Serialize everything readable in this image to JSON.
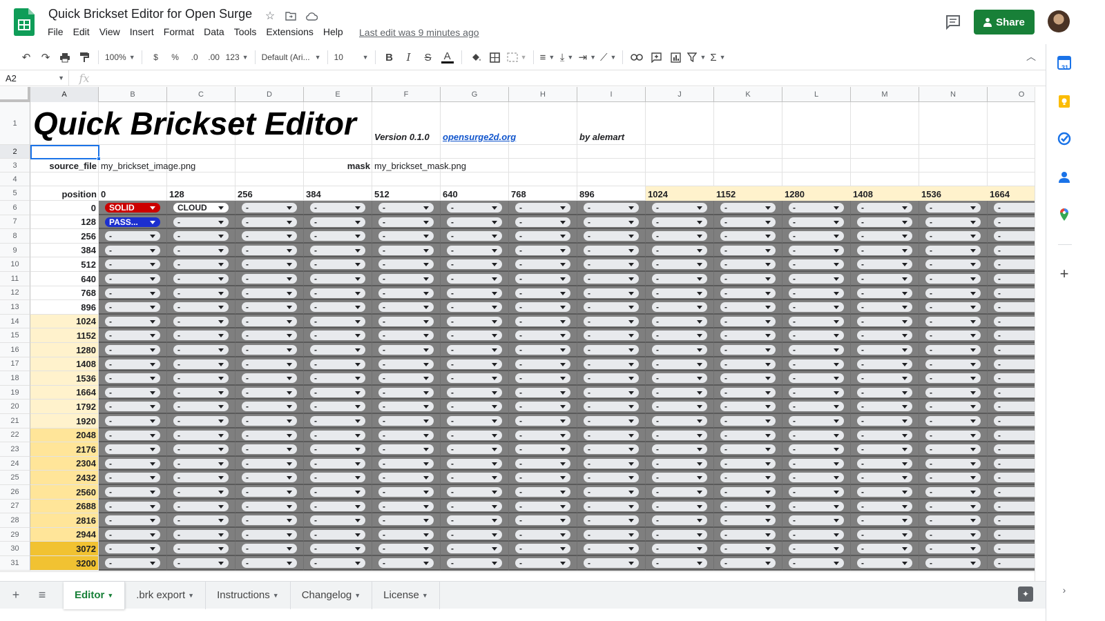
{
  "app": {
    "doc_title": "Quick Brickset Editor for Open Surge",
    "last_edit": "Last edit was 9 minutes ago",
    "share_label": "Share",
    "menu": [
      "File",
      "Edit",
      "View",
      "Insert",
      "Format",
      "Data",
      "Tools",
      "Extensions",
      "Help"
    ]
  },
  "toolbar": {
    "zoom": "100%",
    "currency": "$",
    "percent": "%",
    "dec_less": ".0",
    "dec_more": ".00",
    "number_format": "123",
    "font": "Default (Ari...",
    "font_size": "10"
  },
  "formula_bar": {
    "cell_ref": "A2",
    "fx": "fx"
  },
  "sheet": {
    "title": "Quick Brickset Editor",
    "version": "Version 0.1.0",
    "link": "opensurge2d.org",
    "author": "by alemart",
    "source_label": "source_file",
    "source_value": "my_brickset_image.png",
    "mask_label": "mask",
    "mask_value": "my_brickset_mask.png",
    "position_label": "position",
    "column_letters": [
      "A",
      "B",
      "C",
      "D",
      "E",
      "F",
      "G",
      "H",
      "I",
      "J",
      "K",
      "L",
      "M",
      "N",
      "O"
    ],
    "column_positions": [
      "0",
      "128",
      "256",
      "384",
      "512",
      "640",
      "768",
      "896",
      "1024",
      "1152",
      "1280",
      "1408",
      "1536",
      "1664"
    ],
    "row_positions": [
      "0",
      "128",
      "256",
      "384",
      "512",
      "640",
      "768",
      "896",
      "1024",
      "1152",
      "1280",
      "1408",
      "1536",
      "1664",
      "1792",
      "1920",
      "2048",
      "2176",
      "2304",
      "2432",
      "2560",
      "2688",
      "2816",
      "2944",
      "3072",
      "3200"
    ],
    "row_numbers": [
      "1",
      "2",
      "3",
      "4",
      "5",
      "6",
      "7",
      "8",
      "9",
      "10",
      "11",
      "12",
      "13",
      "14",
      "15",
      "16",
      "17",
      "18",
      "19",
      "20",
      "21",
      "22",
      "23",
      "24",
      "25",
      "26",
      "27",
      "28",
      "29",
      "30",
      "31"
    ],
    "default_chip": "-",
    "special_chips": [
      {
        "row": 0,
        "col": 0,
        "text": "SOLID",
        "style": "red"
      },
      {
        "row": 0,
        "col": 1,
        "text": "CLOUD",
        "style": "white"
      },
      {
        "row": 1,
        "col": 0,
        "text": "PASS...",
        "style": "blue"
      }
    ],
    "colors": {
      "accent": "#188038",
      "dark_cells": "#7f7f7f",
      "highlight_light": "#fff2cc",
      "highlight_mid": "#ffe599",
      "highlight_strong": "#f1c232",
      "solid": "#cc0000",
      "passable": "#1c2fcf"
    }
  },
  "tabs": [
    {
      "label": "Editor",
      "active": true
    },
    {
      "label": ".brk export",
      "active": false
    },
    {
      "label": "Instructions",
      "active": false
    },
    {
      "label": "Changelog",
      "active": false
    },
    {
      "label": "License",
      "active": false
    }
  ],
  "side_icons": [
    "calendar-icon",
    "keep-icon",
    "tasks-icon",
    "contacts-icon",
    "maps-icon",
    "add-icon"
  ],
  "side_calendar_label": "31"
}
